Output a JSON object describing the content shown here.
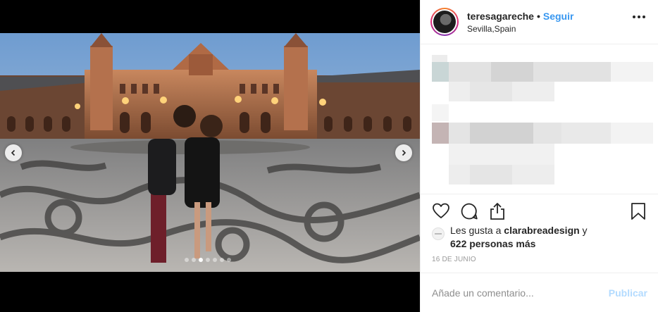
{
  "post": {
    "username": "teresagareche",
    "separator": "•",
    "follow_label": "Seguir",
    "location": "Sevilla,Spain"
  },
  "carousel": {
    "slide_count": 7,
    "active_index": 2
  },
  "likes": {
    "prefix": "Les gusta a ",
    "user": "clarabreadesign",
    "conj": " y",
    "count_text": "622 personas más"
  },
  "date": "16 DE JUNIO",
  "comment": {
    "placeholder": "Añade un comentario...",
    "publish_label": "Publicar"
  },
  "colors": {
    "accent": "#3897f0",
    "publish_disabled": "#b3dbff",
    "secondary_text": "#8e8e8e"
  },
  "icons": {
    "more": "more-options-icon",
    "like": "heart-icon",
    "comment": "comment-bubble-icon",
    "share": "share-icon",
    "save": "bookmark-icon",
    "prev": "chevron-left-icon",
    "next": "chevron-right-icon"
  }
}
